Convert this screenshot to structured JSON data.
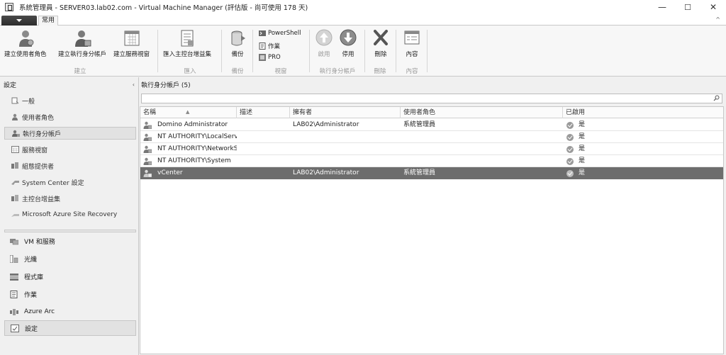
{
  "window": {
    "title": "系統管理員 - SERVER03.lab02.com - Virtual Machine Manager (評估版 - 尚可使用 178 天)",
    "minimize": "—",
    "maximize": "☐",
    "close": "✕"
  },
  "ribbon": {
    "home_tab": "常用",
    "collapse": "^",
    "buttons": {
      "create_user_role": "建立使用者角色",
      "create_run_as": "建立執行身分帳戶",
      "create_service_view": "建立服務視窗",
      "import_console_addin": "匯入主控台增益集",
      "backup": "備份",
      "powershell": "PowerShell",
      "jobs": "作業",
      "pro": "PRO",
      "enable": "啟用",
      "disable": "停用",
      "delete": "刪除",
      "properties": "內容"
    },
    "groups": {
      "create": "建立",
      "import": "匯入",
      "backup": "備份",
      "window": "視窗",
      "run_as_account": "執行身分帳戶",
      "delete": "刪除",
      "properties": "內容"
    }
  },
  "left_pane": {
    "header": "設定",
    "collapse": "‹",
    "nav_items": [
      "一般",
      "使用者角色",
      "執行身分帳戶",
      "服務視窗",
      "組態提供者",
      "System Center 設定",
      "主控台增益集",
      "Microsoft Azure Site Recovery"
    ],
    "workspaces": [
      "VM 和服務",
      "光纖",
      "程式庫",
      "作業",
      "Azure Arc",
      "設定"
    ]
  },
  "right_pane": {
    "header": "執行身分帳戶 (5)",
    "columns": [
      "名稱",
      "描述",
      "擁有者",
      "使用者角色",
      "已啟用"
    ],
    "rows": [
      {
        "name": "Domino Administrator",
        "desc": "",
        "owner": "LAB02\\Administrator",
        "role": "系統管理員",
        "enabled": "是"
      },
      {
        "name": "NT AUTHORITY\\LocalServ",
        "desc": "",
        "owner": "",
        "role": "",
        "enabled": "是"
      },
      {
        "name": "NT AUTHORITY\\NetworkS",
        "desc": "",
        "owner": "",
        "role": "",
        "enabled": "是"
      },
      {
        "name": "NT AUTHORITY\\System",
        "desc": "",
        "owner": "",
        "role": "",
        "enabled": "是"
      },
      {
        "name": "vCenter",
        "desc": "",
        "owner": "LAB02\\Administrator",
        "role": "系統管理員",
        "enabled": "是"
      }
    ]
  },
  "colors": {
    "selected_row": "#6d6d6d",
    "file_tab": "#3a3a3a"
  }
}
